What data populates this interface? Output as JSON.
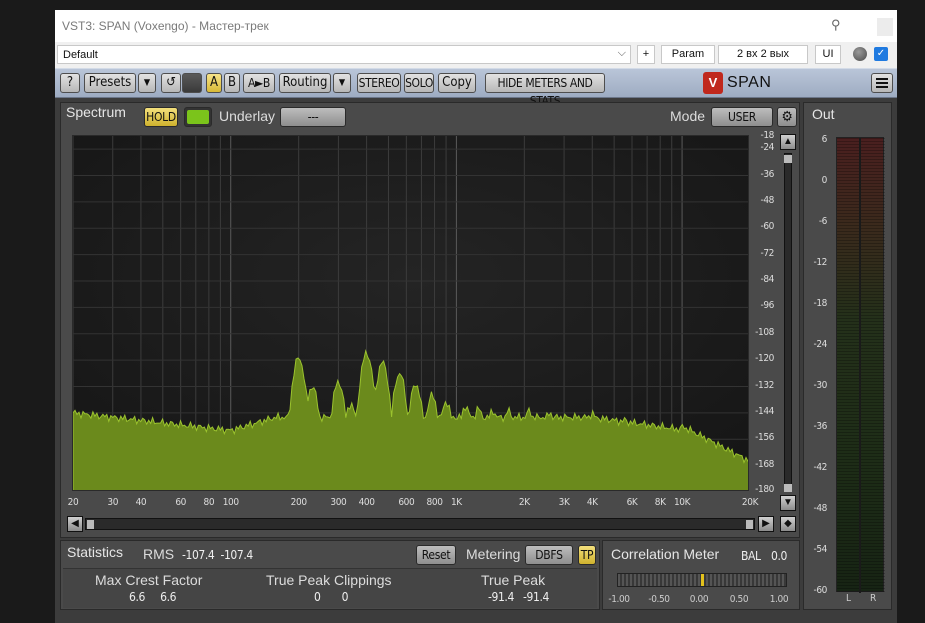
{
  "window": {
    "title": "VST3: SPAN (Voxengo) - Мастер-трек"
  },
  "host_bar": {
    "preset_value": "Default",
    "plus_label": "+",
    "param_label": "Param",
    "io_label": "2 вх 2 вых",
    "ui_label": "UI"
  },
  "toolbar": {
    "help_label": "?",
    "presets_label": "Presets",
    "a_label": "A",
    "b_label": "B",
    "ab_label": "A►B",
    "routing_label": "Routing",
    "stereo_label": "STEREO",
    "solo_label": "SOLO",
    "copy_label": "Copy",
    "hide_label": "HIDE METERS AND STATS",
    "logo_text": "SPAN"
  },
  "spectrum": {
    "title": "Spectrum",
    "hold_label": "HOLD",
    "underlay_label": "Underlay",
    "underlay_value": "---",
    "mode_label": "Mode",
    "mode_value": "USER",
    "db_ticks": [
      "-18",
      "-24",
      "-36",
      "-48",
      "-60",
      "-72",
      "-84",
      "-96",
      "-108",
      "-120",
      "-132",
      "-144",
      "-156",
      "-168",
      "-180"
    ],
    "freq_labels": [
      "20",
      "30",
      "40",
      "60",
      "80",
      "100",
      "200",
      "300",
      "400",
      "600",
      "800",
      "1K",
      "2K",
      "3K",
      "4K",
      "6K",
      "8K",
      "10K",
      "20K"
    ],
    "fill_color": "#6b8a1c"
  },
  "statistics": {
    "title": "Statistics",
    "rms_label": "RMS",
    "rms_values": "-107.4  -107.4",
    "reset_label": "Reset",
    "metering_label": "Metering",
    "metering_value": "DBFS",
    "tp_label": "TP",
    "crest_label": "Max Crest Factor",
    "crest_values": "6.6     6.6",
    "clip_label": "True Peak Clippings",
    "clip_values": "0       0",
    "peak_label": "True Peak",
    "peak_values": "-91.4   -91.4"
  },
  "correlation": {
    "title": "Correlation Meter",
    "bal_label": "BAL",
    "bal_value": "0.0",
    "scale": [
      "-1.00",
      "-0.50",
      "0.00",
      "0.50",
      "1.00"
    ],
    "value": 0.0
  },
  "out": {
    "title": "Out",
    "scale": [
      "6",
      "0",
      "-6",
      "-12",
      "-18",
      "-24",
      "-30",
      "-36",
      "-42",
      "-48",
      "-54",
      "-60"
    ],
    "left_label": "L",
    "right_label": "R"
  }
}
